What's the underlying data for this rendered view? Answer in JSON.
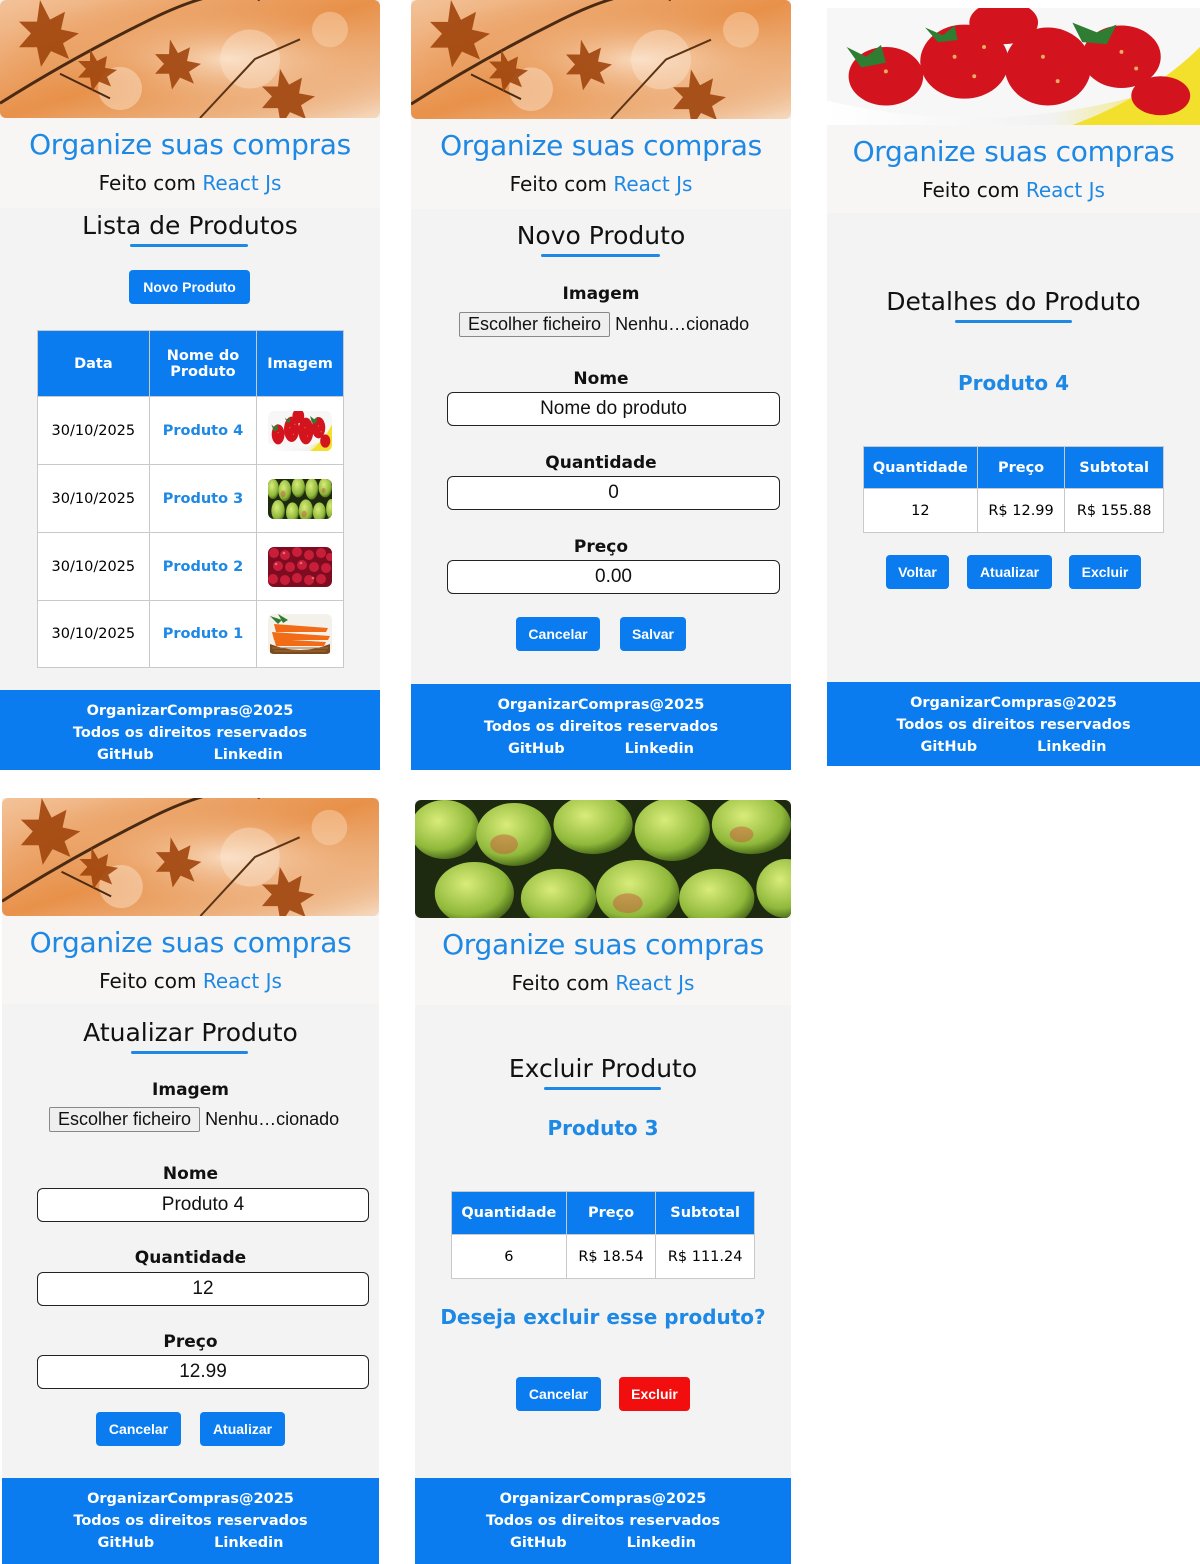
{
  "colors": {
    "accent": "#1e88e5",
    "button": "#0a7cf0",
    "danger": "#f20e0e",
    "footer": "#0a7cf0"
  },
  "common": {
    "brand": "Organize suas compras",
    "made_with_prefix": "Feito com",
    "made_with_tech": "React Js",
    "footer": {
      "copyright": "OrganizarCompras@2025",
      "rights": "Todos os direitos reservados",
      "github": "GitHub",
      "linkedin": "Linkedin"
    }
  },
  "list_page": {
    "title": "Lista de Produtos",
    "new_button": "Novo Produto",
    "columns": [
      "Data",
      "Nome do Produto",
      "Imagem"
    ],
    "rows": [
      {
        "date": "30/10/2025",
        "name": "Produto 4",
        "image": "strawberries"
      },
      {
        "date": "30/10/2025",
        "name": "Produto 3",
        "image": "pears"
      },
      {
        "date": "30/10/2025",
        "name": "Produto 2",
        "image": "cranberries"
      },
      {
        "date": "30/10/2025",
        "name": "Produto 1",
        "image": "carrots"
      }
    ]
  },
  "new_page": {
    "title": "Novo Produto",
    "image_label": "Imagem",
    "file_button": "Escolher ficheiro",
    "file_status": "Nenhu…cionado",
    "name_label": "Nome",
    "name_placeholder": "Nome do produto",
    "qty_label": "Quantidade",
    "qty_value": "0",
    "price_label": "Preço",
    "price_value": "0.00",
    "cancel": "Cancelar",
    "save": "Salvar"
  },
  "details_page": {
    "title": "Detalhes do Produto",
    "product": "Produto 4",
    "columns": [
      "Quantidade",
      "Preço",
      "Subtotal"
    ],
    "values": [
      "12",
      "R$ 12.99",
      "R$ 155.88"
    ],
    "back": "Voltar",
    "update": "Atualizar",
    "delete": "Excluir"
  },
  "update_page": {
    "title": "Atualizar Produto",
    "image_label": "Imagem",
    "file_button": "Escolher ficheiro",
    "file_status": "Nenhu…cionado",
    "name_label": "Nome",
    "name_value": "Produto 4",
    "qty_label": "Quantidade",
    "qty_value": "12",
    "price_label": "Preço",
    "price_value": "12.99",
    "cancel": "Cancelar",
    "update": "Atualizar"
  },
  "delete_page": {
    "title": "Excluir Produto",
    "product": "Produto 3",
    "columns": [
      "Quantidade",
      "Preço",
      "Subtotal"
    ],
    "values": [
      "6",
      "R$ 18.54",
      "R$ 111.24"
    ],
    "question": "Deseja excluir esse produto?",
    "cancel": "Cancelar",
    "delete": "Excluir"
  }
}
